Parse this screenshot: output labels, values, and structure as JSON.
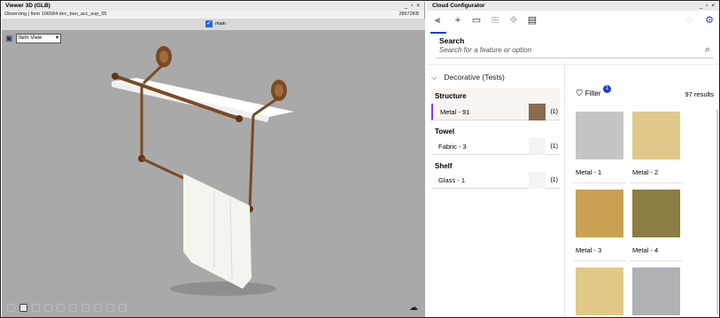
{
  "viewer": {
    "title": "Viewer 3D (GLB)",
    "window_controls": "_ ▫ ×",
    "observing": "Observing | Item 106584:dec_ban_acc_sup_05",
    "file_size": "28672KB",
    "checkbox_label": "main",
    "view_select": "Item View"
  },
  "config": {
    "title": "Cloud Configurator",
    "window_controls": "_ ▫ ×",
    "search_label": "Search",
    "search_placeholder": "Search for a feature or option",
    "group": "Decorative (Tests)",
    "sections": [
      {
        "name": "Structure",
        "option": "Metal - 91",
        "count": "(1)",
        "color": "#8b6a4e"
      },
      {
        "name": "Towel",
        "option": "Fabric - 3",
        "count": "(1)",
        "color": "#f6f6f4"
      },
      {
        "name": "Shelf",
        "option": "Glass - 1",
        "count": "(1)",
        "color": "#f6f6f6"
      }
    ],
    "filter_label": "Filter",
    "filter_count": "1",
    "results": "97 results",
    "cards": [
      {
        "label": "Metal - 1",
        "color": "#c5c5c5"
      },
      {
        "label": "Metal - 2",
        "color": "#e2c78a"
      },
      {
        "label": "Metal - 3",
        "color": "#c9a152"
      },
      {
        "label": "Metal - 4",
        "color": "#8c7d44"
      },
      {
        "label": "",
        "color": "#e0c887"
      },
      {
        "label": "",
        "color": "#b0b1b5"
      }
    ]
  },
  "colors": {
    "accent": "#1d3fd6",
    "selection": "#7a3cff",
    "scene_bg": "#a9a9a9",
    "bronze": "#7a4a22"
  }
}
